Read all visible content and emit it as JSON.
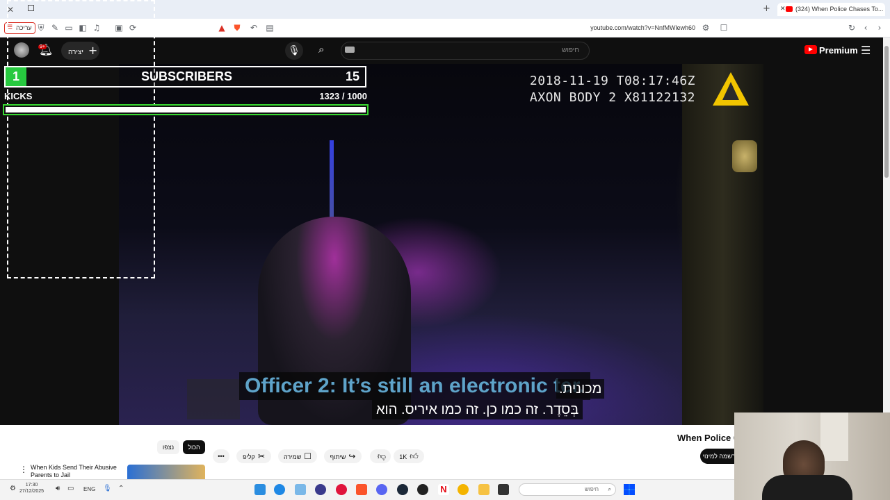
{
  "browser": {
    "tab_title": "(324) When Police Chases To...",
    "url": "youtube.com/watch?v=NnfMWlewh60",
    "toolbar_badge": "עריכה"
  },
  "youtube": {
    "search_placeholder": "חיפוש",
    "create_label": "יצירה",
    "notifications_count": "9+",
    "premium_label": "Premium",
    "keyboard_icon": "keyboard-icon"
  },
  "video": {
    "timestamp_line1": "2018-11-19 T08:17:46Z",
    "timestamp_line2": "AXON BODY 2 X81122132",
    "caption_en": "Officer 2: It’s still an electronic  ter.",
    "caption_he_line1": "מכונית.",
    "caption_he_line2": "בְּסֵדֶר.  זה כמו כן.  זה כמו איריס.  הוא"
  },
  "overlay": {
    "subscribers_label": "SUBSCRIBERS",
    "subscribers_current": "1",
    "subscribers_goal": "15",
    "kicks_label": "KICKS",
    "kicks_count": "1323  / 1000",
    "kicks_progress": 1.0
  },
  "below_video": {
    "video_title": "When Police C",
    "subscribe_label": "הרשמה למינוי",
    "likes": "1K",
    "share_label": "שיתוף",
    "save_label": "שמירה",
    "clip_label": "קליפ",
    "more_label": "•••",
    "filter_all": "הכול",
    "filter_related": "נצפו",
    "rec_title": "When Kids Send Their Abusive Parents to Jail"
  },
  "taskbar": {
    "time": "17:30",
    "date": "27/12/2025",
    "lang": "ENG",
    "search_placeholder": "חיפוש"
  },
  "colors": {
    "youtube_red": "#ff0000",
    "overlay_green": "#27c93f",
    "caption_blue": "#5ea3c9"
  }
}
